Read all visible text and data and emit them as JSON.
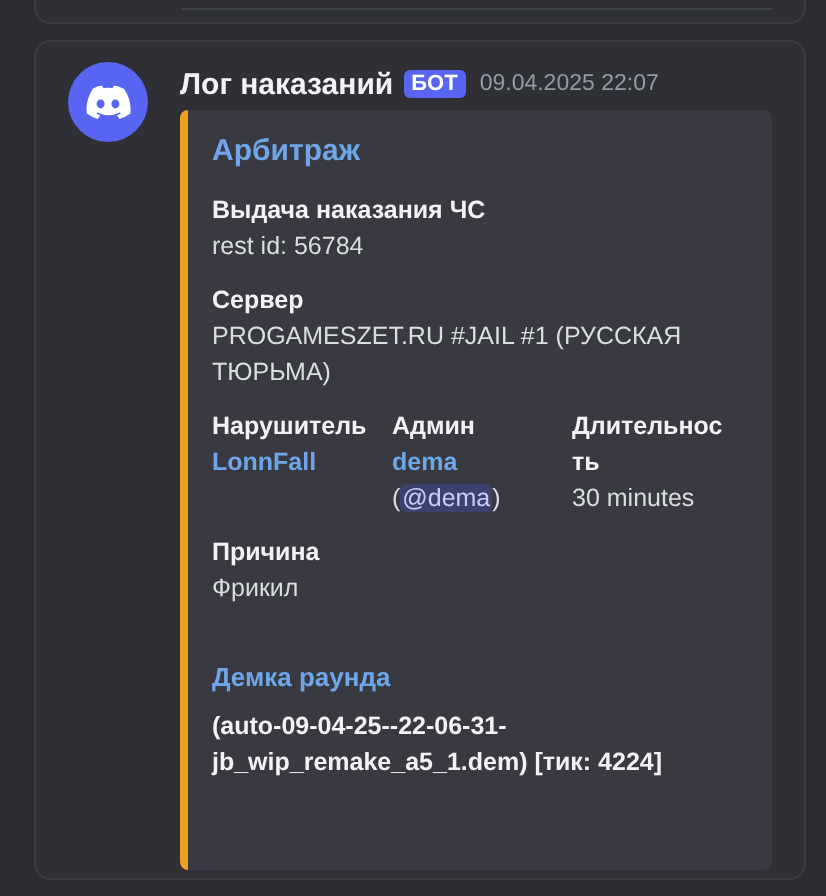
{
  "message": {
    "author": "Лог наказаний",
    "badge": "БОТ",
    "timestamp": "09.04.2025 22:07",
    "embed": {
      "color": "#f0a020",
      "title": "Арбитраж",
      "fields": [
        {
          "kind": "text",
          "name": "Выдача наказания ЧС",
          "value": "rest id: 56784"
        },
        {
          "kind": "text",
          "name": "Сервер",
          "value": "PROGAMESZET.RU #JAIL #1 (РУССКАЯ ТЮРЬМА)"
        },
        {
          "kind": "columns",
          "columns": [
            {
              "kind": "link",
              "name": "Нарушитель",
              "value": "LonnFall"
            },
            {
              "kind": "user",
              "name": "Админ",
              "value": "dema",
              "open": "(",
              "mention": "@dema",
              "close": ")"
            },
            {
              "kind": "text",
              "name": "Длительность",
              "value": "30 minutes"
            }
          ]
        },
        {
          "kind": "text",
          "name": "Причина",
          "value": "Фрикил"
        }
      ],
      "link_title": "Демка раунда",
      "description": "(auto-09-04-25--22-06-31-jb_wip_remake_a5_1.dem) [тик: 4224]"
    }
  }
}
